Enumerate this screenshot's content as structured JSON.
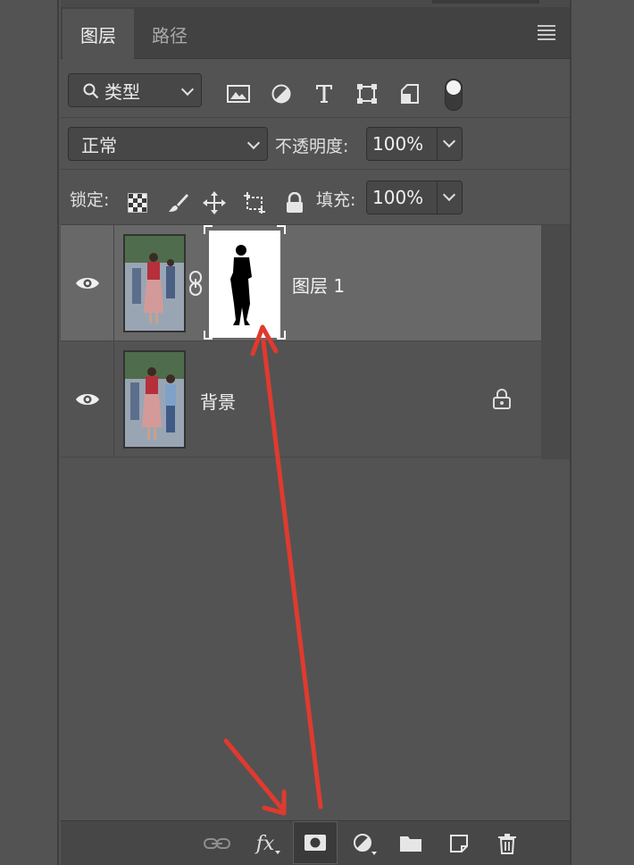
{
  "tabs": [
    {
      "label": "图层"
    },
    {
      "label": "路径"
    }
  ],
  "filter": {
    "label": "类型"
  },
  "blend": {
    "mode": "正常",
    "opacity_label": "不透明度:",
    "opacity_value": "100%"
  },
  "lock": {
    "label": "锁定:",
    "fill_label": "填充:",
    "fill_value": "100%"
  },
  "layers": [
    {
      "name": "图层 1",
      "selected": true,
      "has_mask": true,
      "locked": false
    },
    {
      "name": "背景",
      "selected": false,
      "has_mask": false,
      "locked": true
    }
  ],
  "icons": {
    "filter_bar": [
      "image-filter-icon",
      "adjustment-filter-icon",
      "type-filter-icon",
      "shape-filter-icon",
      "smart-object-filter-icon"
    ],
    "lock_bar": [
      "lock-transparent-pixels-icon",
      "lock-image-pixels-icon",
      "lock-position-icon",
      "lock-artboard-icon",
      "lock-all-icon"
    ],
    "bottom_bar": [
      "link-layers-icon",
      "fx-icon",
      "add-mask-icon",
      "new-adjustment-icon",
      "new-group-icon",
      "new-layer-icon",
      "delete-icon"
    ]
  },
  "bottom": {
    "fx_label": "fx"
  },
  "colors": {
    "panel_bg": "#535353",
    "selected_row": "#686868",
    "annotation_arrow": "#e03a2f"
  }
}
